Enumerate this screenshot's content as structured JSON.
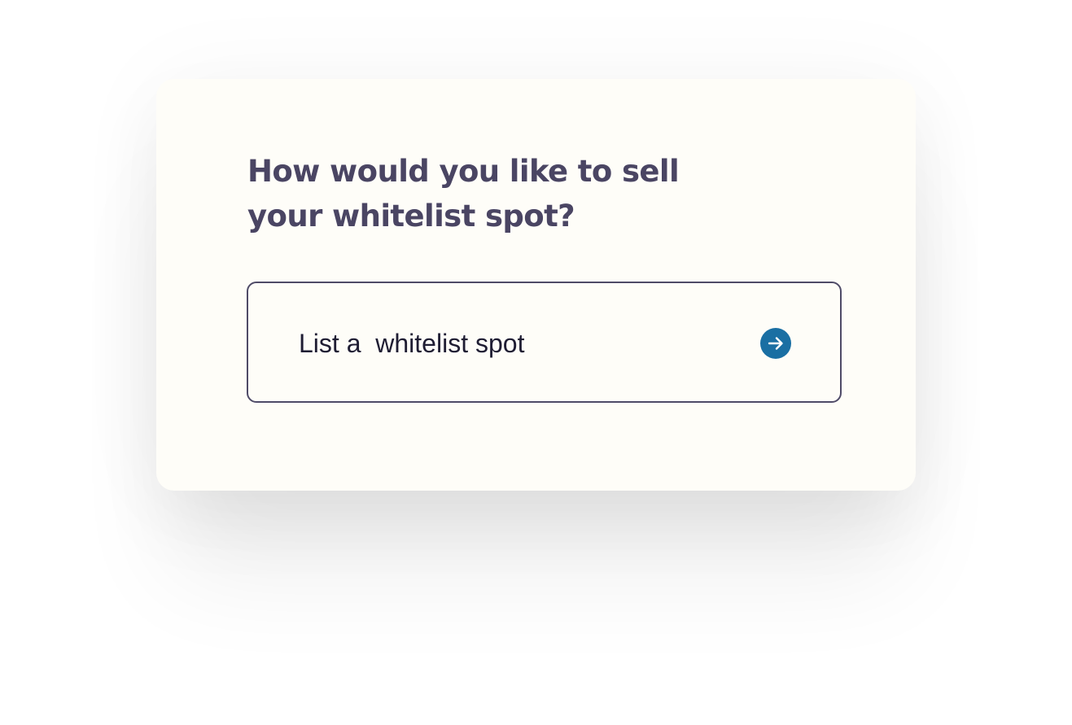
{
  "prompt": {
    "line1": "How would you like to sell",
    "line2": "your whitelist spot?"
  },
  "options": [
    {
      "label": "List a  whitelist spot",
      "icon": "arrow-right-icon"
    }
  ],
  "colors": {
    "card_background": "#fefdf8",
    "heading_text": "#4a4563",
    "option_border": "#4f4b68",
    "option_text": "#1f1d33",
    "accent": "#1a6fa3"
  }
}
